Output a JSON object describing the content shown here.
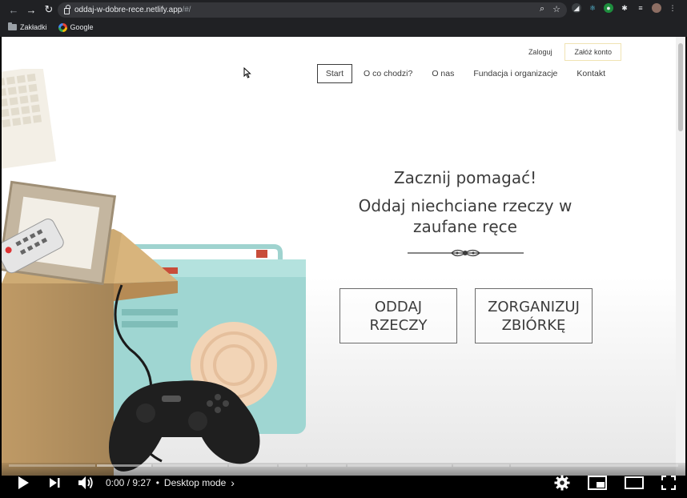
{
  "browser": {
    "url_main": "oddaj-w-dobre-rece.netlify.app",
    "url_path": "/#/",
    "bookmarks": [
      {
        "label": "Zakładki"
      },
      {
        "label": "Google"
      }
    ]
  },
  "site": {
    "top_links": {
      "login": "Zaloguj",
      "register": "Załóż konto"
    },
    "nav": [
      "Start",
      "O co chodzi?",
      "O nas",
      "Fundacja i organizacje",
      "Kontakt"
    ],
    "active_nav": "Start",
    "hero": {
      "title": "Zacznij pomagać!",
      "subtitle_line1": "Oddaj niechciane rzeczy w",
      "subtitle_line2": "zaufane ręce"
    },
    "buttons": {
      "give_line1": "ODDAJ",
      "give_line2": "RZECZY",
      "organize_line1": "ZORGANIZUJ",
      "organize_line2": "ZBIÓRKĘ"
    }
  },
  "player": {
    "time": "0:00 / 9:27",
    "chapter": "Desktop mode",
    "progress": 0.0
  }
}
